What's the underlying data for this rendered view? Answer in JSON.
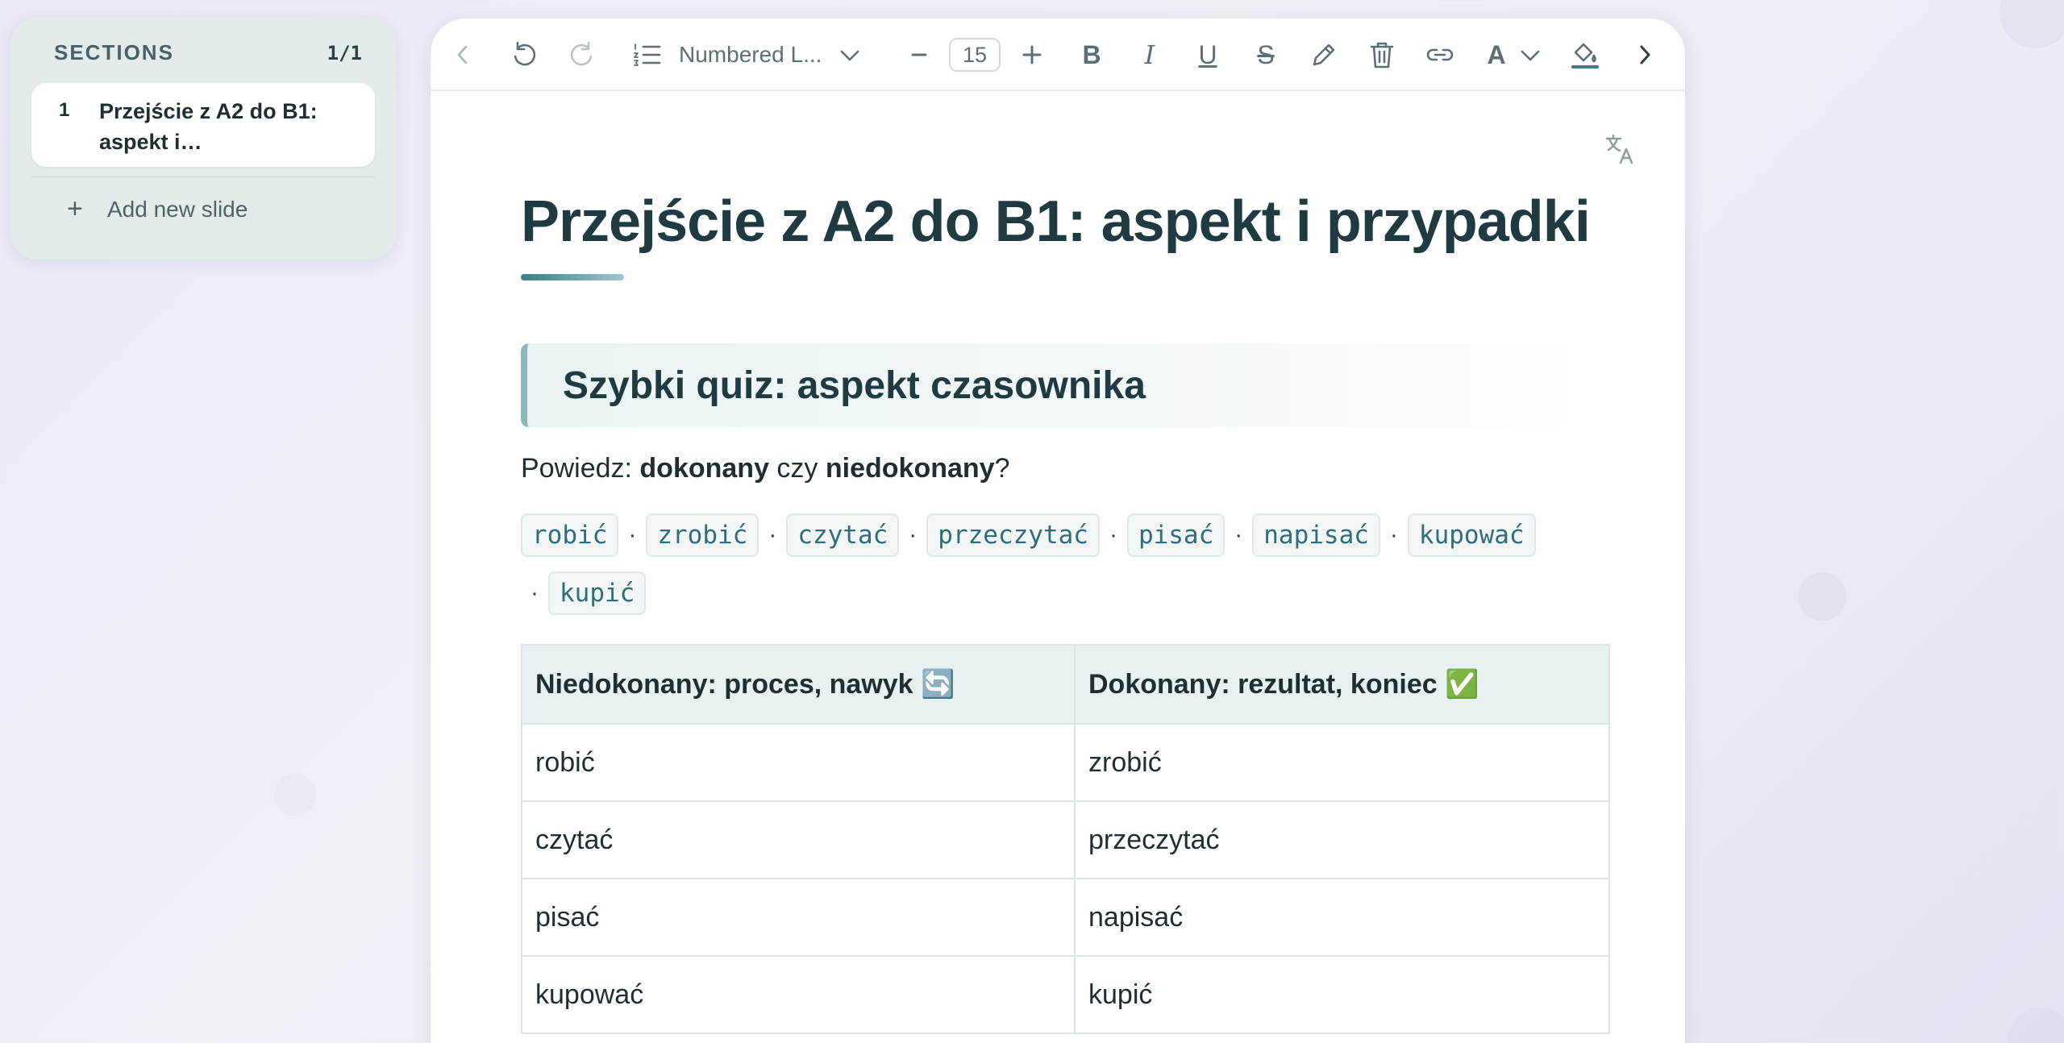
{
  "sections_panel": {
    "title": "SECTIONS",
    "count": "1/1",
    "items": [
      {
        "number": "1",
        "label": "Przejście z A2 do B1: aspekt i…"
      }
    ],
    "add_label": "Add new slide"
  },
  "toolbar": {
    "list_style": "Numbered L...",
    "font_size": "15",
    "icons": [
      "chevron-left-icon",
      "undo-icon",
      "redo-icon",
      "numbered-list-icon",
      "chevron-down-icon",
      "minus-icon",
      "plus-icon",
      "bold-icon",
      "italic-icon",
      "underline-icon",
      "strikethrough-icon",
      "pencil-icon",
      "trash-icon",
      "link-icon",
      "text-color-icon",
      "chevron-down-icon",
      "fill-color-icon",
      "chevron-right-icon"
    ]
  },
  "document": {
    "title": "Przejście z A2 do B1: aspekt i przypadki",
    "callout_heading": "Szybki quiz: aspekt czasownika",
    "prompt": {
      "before": "Powiedz: ",
      "bold1": "dokonany",
      "middle": " czy ",
      "bold2": "niedokonany",
      "after": "?"
    },
    "chips": [
      "robić",
      "zrobić",
      "czytać",
      "przeczytać",
      "pisać",
      "napisać",
      "kupować",
      "kupić"
    ],
    "chip_separator": "·",
    "table": {
      "headers": [
        "Niedokonany: proces, nawyk 🔄",
        "Dokonany: rezultat, koniec ✅"
      ],
      "rows": [
        [
          "robić",
          "zrobić"
        ],
        [
          "czytać",
          "przeczytać"
        ],
        [
          "pisać",
          "napisać"
        ],
        [
          "kupować",
          "kupić"
        ]
      ]
    }
  },
  "colors": {
    "accent": "#3d7e8c",
    "chip_text": "#2f6d7c",
    "heading_text": "#1f3a40",
    "table_header_bg": "#e8f1f1"
  }
}
